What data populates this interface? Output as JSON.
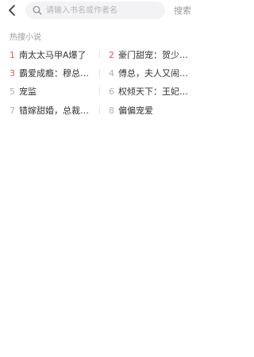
{
  "search": {
    "placeholder": "请输入书名或作者名",
    "value": "",
    "button_label": "搜索"
  },
  "hot": {
    "section_title": "热搜小说",
    "items": [
      {
        "rank": "1",
        "title": "南太太马甲A爆了"
      },
      {
        "rank": "2",
        "title": "豪门甜宠：贺少…"
      },
      {
        "rank": "3",
        "title": "霸爱成瘾：穆总…"
      },
      {
        "rank": "4",
        "title": "傅总，夫人又闹…"
      },
      {
        "rank": "5",
        "title": "宠监"
      },
      {
        "rank": "6",
        "title": "权倾天下：王妃…"
      },
      {
        "rank": "7",
        "title": "错嫁甜婚，总裁…"
      },
      {
        "rank": "8",
        "title": "偏偏宠爱"
      }
    ]
  },
  "colors": {
    "rank_top": "#e8565c",
    "rank_normal": "#b0b0b0",
    "text": "#333333",
    "muted": "#9a9a9a"
  }
}
